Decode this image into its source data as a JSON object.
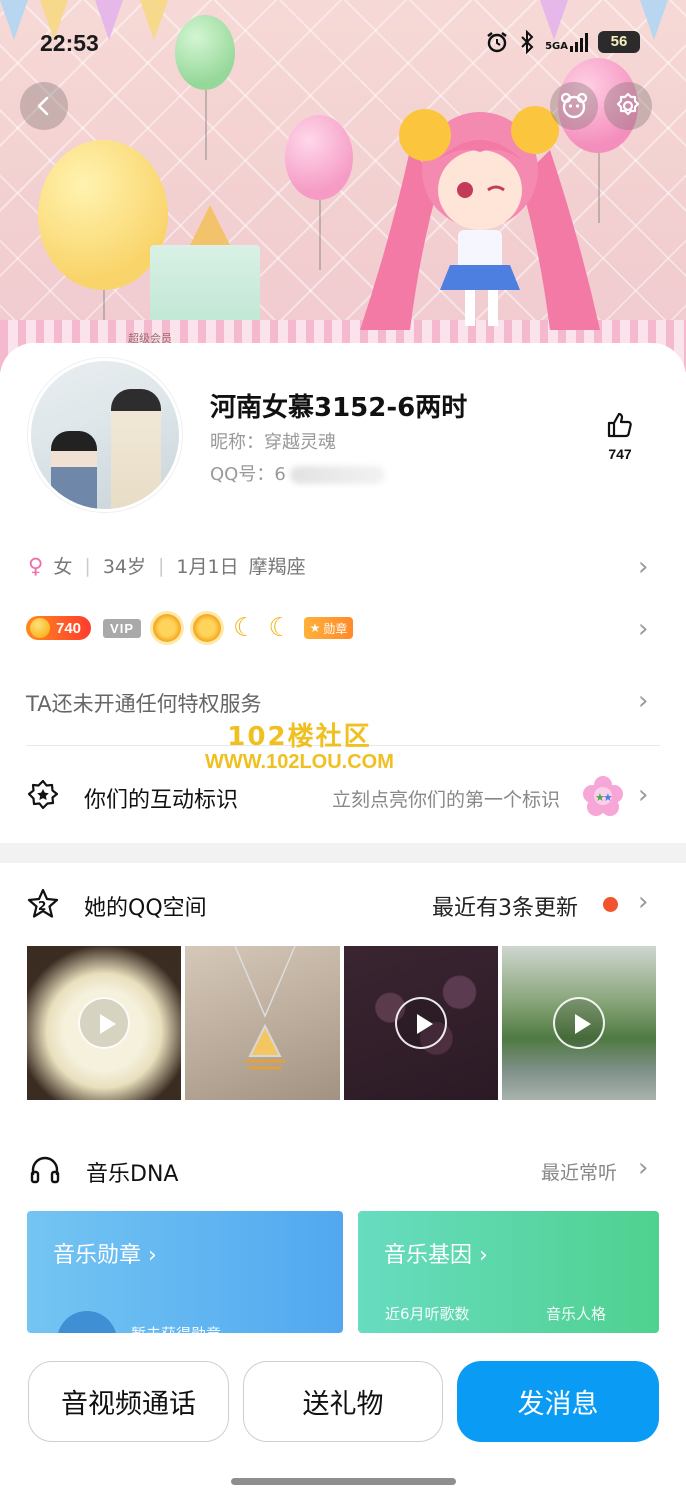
{
  "status_bar": {
    "time": "22:53",
    "network": "5GA",
    "battery": "56",
    "icons": [
      "alarm-icon",
      "bluetooth-icon",
      "signal-icon",
      "battery-icon"
    ]
  },
  "header": {
    "super_member_label": "超级会员",
    "buttons": [
      "back-icon",
      "pet-icon",
      "gear-icon"
    ]
  },
  "profile": {
    "name": "河南女慕3152-6两时",
    "nickname_label": "昵称：",
    "nickname": "穿越灵魂",
    "qq_label": "QQ号：",
    "qq_partial": "6",
    "likes": "747",
    "gender": "女",
    "age": "34岁",
    "birthday": "1月1日",
    "zodiac": "摩羯座"
  },
  "badges": {
    "level_value": "740",
    "vip_label": "VIP",
    "medal_label": "勋章",
    "level_icons": [
      "sun-icon",
      "sun-icon",
      "moon-icon",
      "moon-icon"
    ]
  },
  "privilege": {
    "text": "TA还未开通任何特权服务"
  },
  "watermark": {
    "line1": "102楼社区",
    "line2": "WWW.102LOU.COM"
  },
  "interaction": {
    "title": "你们的互动标识",
    "hint": "立刻点亮你们的第一个标识"
  },
  "qzone": {
    "title": "她的QQ空间",
    "updates": "最近有3条更新"
  },
  "music": {
    "title": "音乐DNA",
    "recent": "最近常听",
    "badge_card": {
      "title": "音乐勋章",
      "sub": "暂未获得勋章"
    },
    "gene_card": {
      "title": "音乐基因",
      "stat1": "近6月听歌数",
      "stat2": "音乐人格"
    }
  },
  "actions": {
    "call": "音视频通话",
    "gift": "送礼物",
    "message": "发消息"
  },
  "colors": {
    "primary_button": "#0a9cf5",
    "female_icon": "#f06eaa",
    "update_dot": "#f2542d",
    "music_badge_card": "#51a8f0",
    "music_gene_card": "#4fd18f"
  }
}
